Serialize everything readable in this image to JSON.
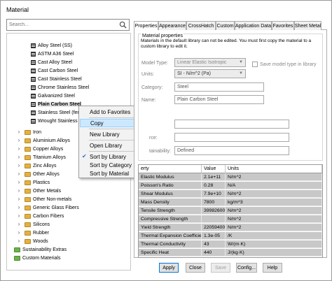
{
  "window": {
    "title": "Material"
  },
  "search": {
    "placeholder": "Search..."
  },
  "tree": {
    "materials": [
      "Alloy Steel (SS)",
      "ASTM A36 Steel",
      "Cast Alloy Steel",
      "Cast Carbon Steel",
      "Cast Stainless Steel",
      "Chrome Stainless Steel",
      "Galvanized Steel",
      "Plain Carbon Steel",
      "Stainless Steel (ferr",
      "Wrought Stainless"
    ],
    "categories": [
      "Iron",
      "Aluminium Alloys",
      "Copper Alloys",
      "Titanium Alloys",
      "Zinc Alloys",
      "Other Alloys",
      "Plastics",
      "Other Metals",
      "Other Non-metals",
      "Generic Glass Fibers",
      "Carbon Fibers",
      "Silicons",
      "Rubber",
      "Woods"
    ],
    "libraries": [
      "Sustainability Extras",
      "Custom Materials"
    ]
  },
  "context_menu": {
    "items": [
      "Add to Favorites",
      "Copy",
      "New Library",
      "Open Library",
      "Sort by Library",
      "Sort by Category",
      "Sort by Material"
    ],
    "highlighted": "Copy",
    "checked": "Sort by Library"
  },
  "tabs": [
    "Properties",
    "Appearance",
    "CrossHatch",
    "Custom",
    "Application Data",
    "Favorites",
    "Sheet Metal"
  ],
  "properties": {
    "group_label": "Material properties",
    "note": "Materials in the default library can not be edited. You must first copy the material to a custom library to edit it.",
    "model_type_label": "Model Type:",
    "model_type_value": "Linear Elastic Isotropic",
    "save_model_label": "Save model type in library",
    "units_label": "Units:",
    "units_value": "SI - N/m^2 (Pa)",
    "category_label": "Category:",
    "category_value": "Steel",
    "name_label": "Name:",
    "name_value": "Plain Carbon Steel",
    "source_label": "rce:",
    "sustainability_label": "tainability:",
    "sustainability_value": "Defined"
  },
  "table": {
    "headers": [
      "erty",
      "Value",
      "Units"
    ],
    "rows": [
      [
        "Elastic Modulus",
        "2.1e+11",
        "N/m^2"
      ],
      [
        "Poisson's Ratio",
        "0.28",
        "N/A"
      ],
      [
        "Shear Modulus",
        "7.9e+10",
        "N/m^2"
      ],
      [
        "Mass Density",
        "7800",
        "kg/m^3"
      ],
      [
        "Tensile Strength",
        "399826000",
        "N/m^2"
      ],
      [
        "Compressive Strength",
        "",
        "N/m^2"
      ],
      [
        "Yield Strength",
        "220594000",
        "N/m^2"
      ],
      [
        "Thermal Expansion Coefficient",
        "1.3e-05",
        "/K"
      ],
      [
        "Thermal Conductivity",
        "43",
        "W/(m·K)"
      ],
      [
        "Specific Heat",
        "440",
        "J/(kg·K)"
      ]
    ]
  },
  "buttons": [
    "Apply",
    "Close",
    "Save",
    "Config...",
    "Help"
  ],
  "colors": {
    "highlight": "#cce8ff",
    "arrow": "#e0202a",
    "table_row": "#c8c8c8",
    "primary_border": "#0078d7"
  }
}
